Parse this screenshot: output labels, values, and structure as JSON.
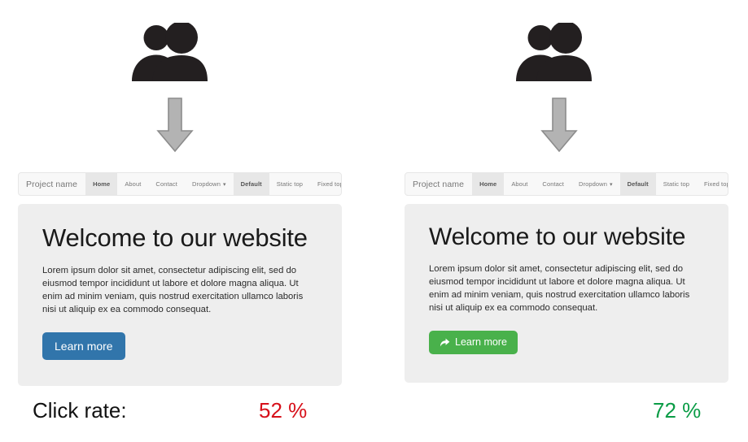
{
  "comparison": {
    "caption_label": "Click rate:",
    "colors": {
      "variant_a_rate": "#d7101a",
      "variant_b_rate": "#0a9c46",
      "button_primary": "#3175ab",
      "button_success": "#49b14b",
      "jumbotron_bg": "#eeeeee",
      "navbar_bg": "#f8f8f8",
      "navbar_active_bg": "#e7e7e7",
      "arrow_fill": "#b3b3b3",
      "users_icon": "#231f20"
    }
  },
  "variants": [
    {
      "id": "variant-a",
      "users_icon_name": "users-icon",
      "arrow_icon_name": "arrow-down-icon",
      "navbar": {
        "brand": "Project name",
        "items": [
          {
            "label": "Home",
            "active": true,
            "caret": false
          },
          {
            "label": "About",
            "active": false,
            "caret": false
          },
          {
            "label": "Contact",
            "active": false,
            "caret": false
          },
          {
            "label": "Dropdown",
            "active": false,
            "caret": true
          },
          {
            "label": "Default",
            "active": true,
            "caret": false
          },
          {
            "label": "Static top",
            "active": false,
            "caret": false
          },
          {
            "label": "Fixed top",
            "active": false,
            "caret": false
          }
        ],
        "caret_glyph": "▾"
      },
      "jumbotron": {
        "title": "Welcome to our website",
        "body": "Lorem ipsum dolor sit amet, consectetur adipiscing elit, sed do eiusmod tempor incididunt ut labore et dolore magna aliqua. Ut enim ad minim veniam, quis nostrud exercitation ullamco laboris nisi ut aliquip ex ea commodo consequat.",
        "button_label": "Learn more",
        "button_style": "primary",
        "button_has_icon": false
      },
      "click_rate": "52 %"
    },
    {
      "id": "variant-b",
      "users_icon_name": "users-icon",
      "arrow_icon_name": "arrow-down-icon",
      "navbar": {
        "brand": "Project name",
        "items": [
          {
            "label": "Home",
            "active": true,
            "caret": false
          },
          {
            "label": "About",
            "active": false,
            "caret": false
          },
          {
            "label": "Contact",
            "active": false,
            "caret": false
          },
          {
            "label": "Dropdown",
            "active": false,
            "caret": true
          },
          {
            "label": "Default",
            "active": true,
            "caret": false
          },
          {
            "label": "Static top",
            "active": false,
            "caret": false
          },
          {
            "label": "Fixed top",
            "active": false,
            "caret": false
          }
        ],
        "caret_glyph": "▾"
      },
      "jumbotron": {
        "title": "Welcome to our website",
        "body": "Lorem ipsum dolor sit amet, consectetur adipiscing elit, sed do eiusmod tempor incididunt ut labore et dolore magna aliqua. Ut enim ad minim veniam, quis nostrud exercitation ullamco laboris nisi ut aliquip ex ea commodo consequat.",
        "button_label": "Learn more",
        "button_style": "success",
        "button_has_icon": true,
        "button_icon_name": "share-arrow-icon"
      },
      "click_rate": "72 %"
    }
  ]
}
